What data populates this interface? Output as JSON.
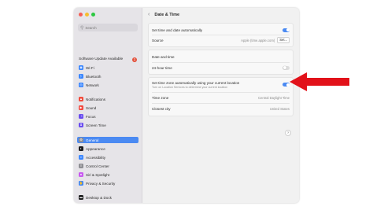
{
  "colors": {
    "accent": "#4b8af2",
    "arrow": "#e2121a",
    "close": "#f55f55",
    "minimize": "#f6be2f",
    "zoom": "#2bc840"
  },
  "sidebar": {
    "search_placeholder": "Search",
    "update": {
      "label": "Software Update Available",
      "count": "1"
    },
    "items": [
      {
        "label": "Wi-Fi",
        "icon": "wifi-icon",
        "color": "#3a86ff"
      },
      {
        "label": "Bluetooth",
        "icon": "bluetooth-icon",
        "color": "#3a86ff"
      },
      {
        "label": "Network",
        "icon": "globe-icon",
        "color": "#3a86ff"
      },
      {
        "label": "Notifications",
        "icon": "bell-icon",
        "color": "#f24a3a"
      },
      {
        "label": "Sound",
        "icon": "speaker-icon",
        "color": "#f2453a"
      },
      {
        "label": "Focus",
        "icon": "moon-icon",
        "color": "#6a4df0"
      },
      {
        "label": "Screen Time",
        "icon": "hourglass-icon",
        "color": "#6a4df0"
      },
      {
        "label": "General",
        "icon": "gear-icon",
        "color": "#8e8e93"
      },
      {
        "label": "Appearance",
        "icon": "appearance-icon",
        "color": "#1c1c1e"
      },
      {
        "label": "Accessibility",
        "icon": "accessibility-icon",
        "color": "#3a86ff"
      },
      {
        "label": "Control Center",
        "icon": "control-center-icon",
        "color": "#8e8e93"
      },
      {
        "label": "Siri & Spotlight",
        "icon": "siri-icon",
        "color": "#c85af0"
      },
      {
        "label": "Privacy & Security",
        "icon": "hand-icon",
        "color": "#3a86ff"
      },
      {
        "label": "Desktop & Dock",
        "icon": "dock-icon",
        "color": "#1c1c1e"
      }
    ],
    "active_index": 7
  },
  "main": {
    "title": "Date & Time",
    "card1": {
      "auto_label": "Set time and date automatically",
      "auto_on": true,
      "source_label": "Source",
      "source_value": "Apple (time.apple.com)",
      "set_button": "Set..."
    },
    "card2": {
      "date_label": "Date and time",
      "h24_label": "24-hour time",
      "h24_on": false
    },
    "card3": {
      "tz_auto_label": "Set time zone automatically using your current location",
      "tz_auto_sub": "Turn on Location Services to determine your current location",
      "tz_auto_on": true,
      "tz_label": "Time zone",
      "tz_value": "Central Daylight Time",
      "city_label": "Closest city",
      "city_value": "United States"
    },
    "help": "?"
  }
}
